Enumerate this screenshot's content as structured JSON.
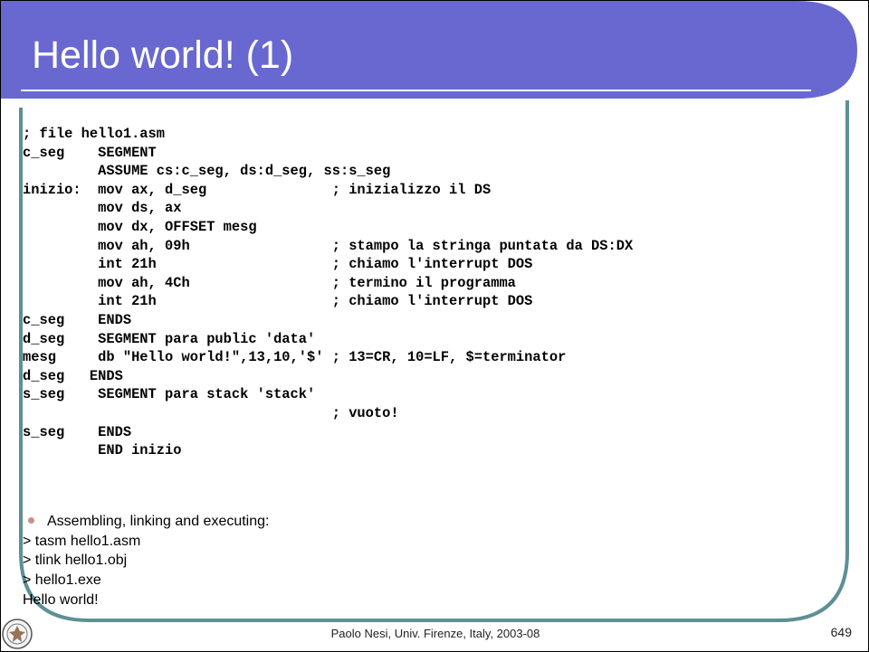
{
  "slide": {
    "title": "Hello world! (1)",
    "code_lines": [
      "; file hello1.asm",
      "c_seg    SEGMENT",
      "         ASSUME cs:c_seg, ds:d_seg, ss:s_seg",
      "inizio:  mov ax, d_seg               ; inizializzo il DS",
      "         mov ds, ax",
      "         mov dx, OFFSET mesg",
      "         mov ah, 09h                 ; stampo la stringa puntata da DS:DX",
      "         int 21h                     ; chiamo l'interrupt DOS",
      "         mov ah, 4Ch                 ; termino il programma",
      "         int 21h                     ; chiamo l'interrupt DOS",
      "c_seg    ENDS",
      "d_seg    SEGMENT para public 'data'",
      "mesg     db \"Hello world!\",13,10,'$' ; 13=CR, 10=LF, $=terminator",
      "d_seg   ENDS",
      "s_seg    SEGMENT para stack 'stack'",
      "                                     ; vuoto!",
      "s_seg    ENDS",
      "         END inizio"
    ],
    "bullet_text": "Assembling, linking and executing:",
    "steps": [
      "> tasm hello1.asm",
      "> tlink hello1.obj",
      "> hello1.exe",
      "Hello world!"
    ],
    "footer": "Paolo Nesi, Univ. Firenze, Italy, 2003-08",
    "page_number": "649"
  },
  "colors": {
    "header_bg": "#6868d0",
    "frame_teal": "#5f8f94",
    "bullet": "#c98e8e"
  },
  "icons": {
    "logo": "university-seal-icon"
  }
}
